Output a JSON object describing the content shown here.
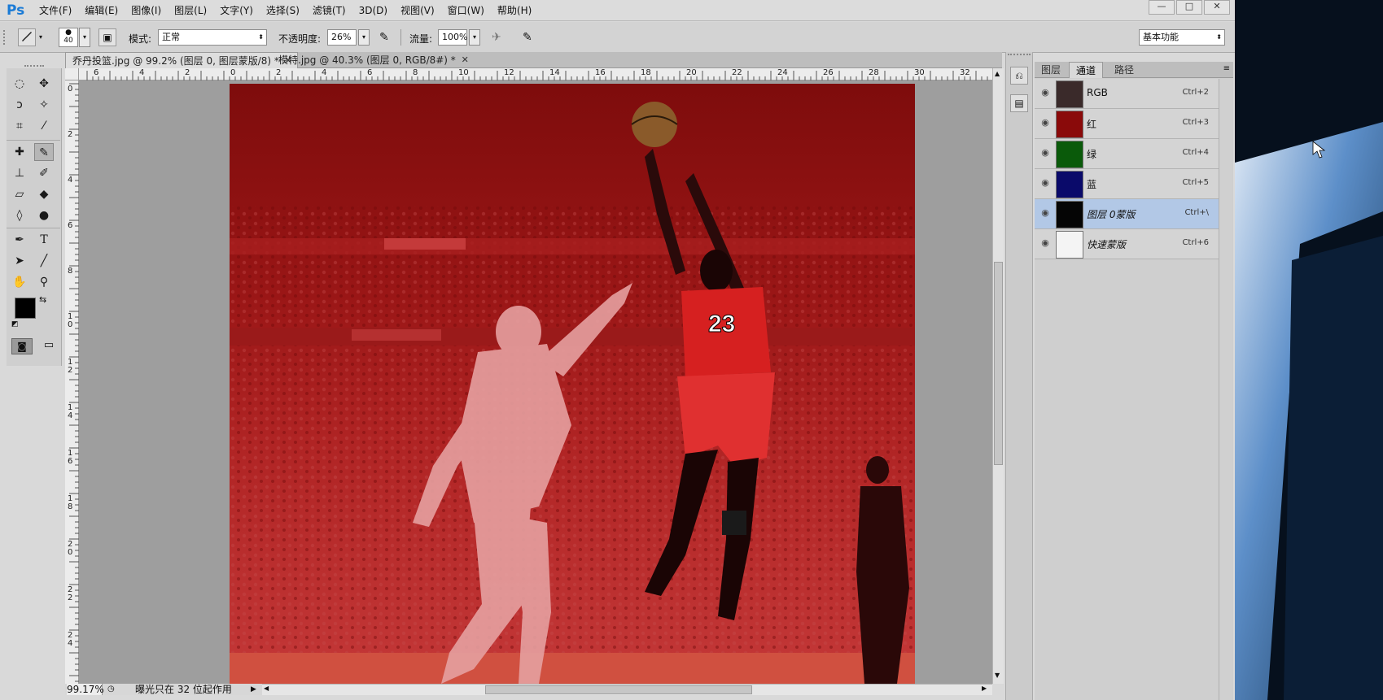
{
  "menubar": {
    "logo": "Ps",
    "items": [
      "文件(F)",
      "编辑(E)",
      "图像(I)",
      "图层(L)",
      "文字(Y)",
      "选择(S)",
      "滤镜(T)",
      "3D(D)",
      "视图(V)",
      "窗口(W)",
      "帮助(H)"
    ],
    "window_controls": [
      "—",
      "□",
      "✕"
    ]
  },
  "options": {
    "brush_size": "40",
    "mode_label": "模式:",
    "mode_value": "正常",
    "opacity_label": "不透明度:",
    "opacity_value": "26%",
    "flow_label": "流量:",
    "flow_value": "100%",
    "workspace": "基本功能"
  },
  "tabs": [
    {
      "label": "乔丹投篮.jpg @ 99.2% (图层 0, 图层蒙版/8) *",
      "close": "✕"
    },
    {
      "label": "模特.jpg @ 40.3% (图层 0, RGB/8#) *",
      "close": "✕"
    }
  ],
  "ruler_h": [
    "6",
    "4",
    "2",
    "0",
    "2",
    "4",
    "6",
    "8",
    "10",
    "12",
    "14",
    "16",
    "18",
    "20",
    "22",
    "24",
    "26",
    "28",
    "30",
    "32"
  ],
  "ruler_v": [
    "0",
    "2",
    "4",
    "6",
    "8",
    "10",
    "12",
    "14",
    "16",
    "18",
    "20",
    "22",
    "24"
  ],
  "status": {
    "zoom": "99.17%",
    "message": "曝光只在 32 位起作用"
  },
  "panel": {
    "tabs": [
      "图层",
      "通道",
      "路径"
    ],
    "channels": [
      {
        "name": "RGB",
        "shortcut": "Ctrl+2",
        "italic": false,
        "selected": false,
        "thumb_color": "#3a2a2a"
      },
      {
        "name": "红",
        "shortcut": "Ctrl+3",
        "italic": false,
        "selected": false,
        "thumb_color": "#8a0a0a"
      },
      {
        "name": "绿",
        "shortcut": "Ctrl+4",
        "italic": false,
        "selected": false,
        "thumb_color": "#0a5a0a"
      },
      {
        "name": "蓝",
        "shortcut": "Ctrl+5",
        "italic": false,
        "selected": false,
        "thumb_color": "#0a0a6a"
      },
      {
        "name": "图层 0蒙版",
        "shortcut": "Ctrl+\\",
        "italic": true,
        "selected": true,
        "thumb_color": "#050505"
      },
      {
        "name": "快速蒙版",
        "shortcut": "Ctrl+6",
        "italic": true,
        "selected": false,
        "thumb_color": "#f4f4f4"
      }
    ]
  }
}
